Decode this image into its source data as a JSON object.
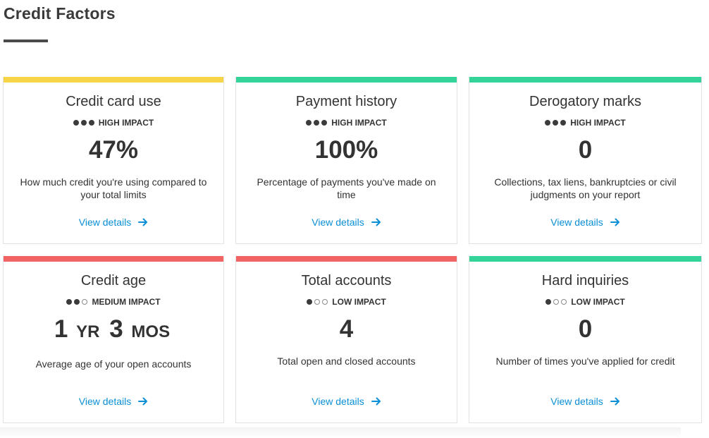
{
  "page": {
    "title": "Credit Factors"
  },
  "colors": {
    "yellow": "#f8d548",
    "green": "#34d399",
    "red": "#f26464",
    "link": "#0a8fd6"
  },
  "cards": [
    {
      "title": "Credit card use",
      "impact": "HIGH IMPACT",
      "impact_level": 3,
      "bar_color": "#f8d548",
      "value": "47%",
      "description": "How much credit you're using compared to your total limits",
      "link": "View details"
    },
    {
      "title": "Payment history",
      "impact": "HIGH IMPACT",
      "impact_level": 3,
      "bar_color": "#34d399",
      "value": "100%",
      "description": "Percentage of payments you've made on time",
      "link": "View details"
    },
    {
      "title": "Derogatory marks",
      "impact": "HIGH IMPACT",
      "impact_level": 3,
      "bar_color": "#34d399",
      "value": "0",
      "description": "Collections, tax liens, bankruptcies or civil judgments on your report",
      "link": "View details"
    },
    {
      "title": "Credit age",
      "impact": "MEDIUM IMPACT",
      "impact_level": 2,
      "bar_color": "#f26464",
      "value_years": "1",
      "value_years_unit": "YR",
      "value_months": "3",
      "value_months_unit": "MOS",
      "description": "Average age of your open accounts",
      "link": "View details"
    },
    {
      "title": "Total accounts",
      "impact": "LOW IMPACT",
      "impact_level": 1,
      "bar_color": "#f26464",
      "value": "4",
      "description": "Total open and closed accounts",
      "link": "View details"
    },
    {
      "title": "Hard inquiries",
      "impact": "LOW IMPACT",
      "impact_level": 1,
      "bar_color": "#34d399",
      "value": "0",
      "description": "Number of times you've applied for credit",
      "link": "View details"
    }
  ]
}
